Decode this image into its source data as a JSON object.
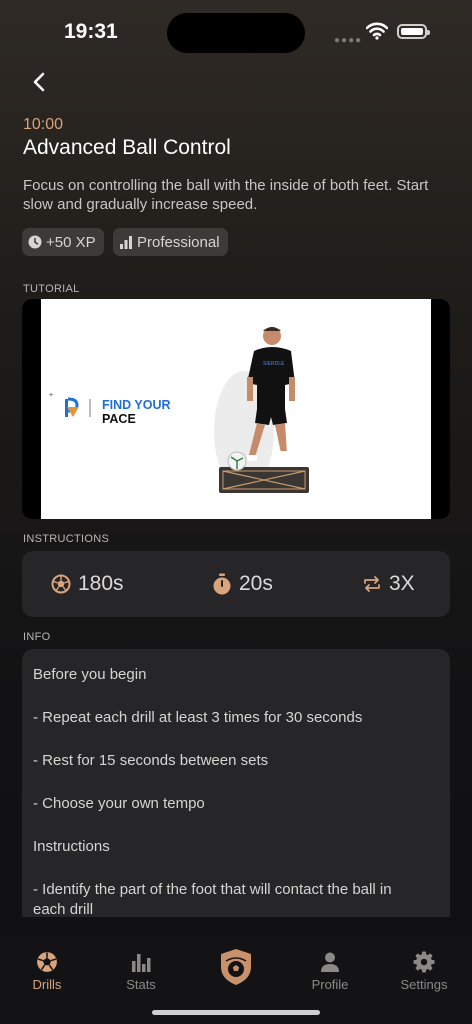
{
  "status_bar": {
    "time": "19:31"
  },
  "drill": {
    "duration": "10:00",
    "title": "Advanced Ball Control",
    "description": "Focus on controlling the ball with the inside of both feet. Start slow and gradually increase speed.",
    "tags": [
      {
        "icon": "clock-icon",
        "label": "+50 XP"
      },
      {
        "icon": "signal-bars-icon",
        "label": "Professional"
      }
    ]
  },
  "tutorial": {
    "label": "TUTORIAL",
    "video_logo_text_1": "FIND YOUR",
    "video_logo_text_2": "PACE",
    "shirt_text": "SIERDLE"
  },
  "instructions": {
    "label": "INSTRUCTIONS",
    "stats": [
      {
        "icon": "football-icon",
        "value": "180s"
      },
      {
        "icon": "stopwatch-icon",
        "value": "20s"
      },
      {
        "icon": "repeat-icon",
        "value": "3X"
      }
    ]
  },
  "info": {
    "label": "INFO",
    "lines": [
      "Before you begin",
      "",
      "- Repeat each drill at least 3 times for 30 seconds",
      "",
      "- Rest for 15 seconds between sets",
      "",
      "- Choose your own tempo",
      "",
      "Instructions",
      "",
      "- Identify the part of the foot that will contact the ball in each drill"
    ]
  },
  "tabbar": {
    "tabs": [
      {
        "label": "Drills",
        "icon": "football-icon",
        "active": true
      },
      {
        "label": "Stats",
        "icon": "bar-chart-icon",
        "active": false
      },
      {
        "label": "",
        "icon": "shield-ball-icon",
        "active": false
      },
      {
        "label": "Profile",
        "icon": "person-icon",
        "active": false
      },
      {
        "label": "Settings",
        "icon": "gear-icon",
        "active": false
      }
    ]
  },
  "colors": {
    "accent": "#d9a37b",
    "card": "#262629",
    "tag_bg": "#3d3a37",
    "logo_blue": "#1f6fd6"
  }
}
